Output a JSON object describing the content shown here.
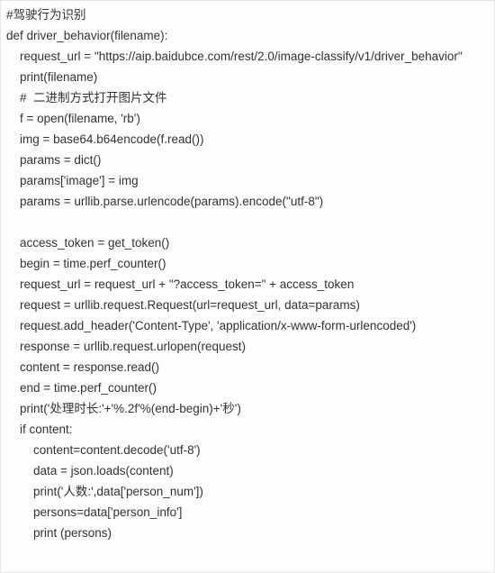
{
  "code": {
    "lines": [
      "#驾驶行为识别",
      "def driver_behavior(filename):",
      "    request_url = \"https://aip.baidubce.com/rest/2.0/image-classify/v1/driver_behavior\"",
      "    print(filename)",
      "    #  二进制方式打开图片文件",
      "    f = open(filename, 'rb')",
      "    img = base64.b64encode(f.read())",
      "    params = dict()",
      "    params['image'] = img",
      "    params = urllib.parse.urlencode(params).encode(\"utf-8\")",
      "",
      "    access_token = get_token()",
      "    begin = time.perf_counter()",
      "    request_url = request_url + \"?access_token=\" + access_token",
      "    request = urllib.request.Request(url=request_url, data=params)",
      "    request.add_header('Content-Type', 'application/x-www-form-urlencoded')",
      "    response = urllib.request.urlopen(request)",
      "    content = response.read()",
      "    end = time.perf_counter()",
      "    print('处理时长:'+'%.2f'%(end-begin)+'秒')",
      "    if content:",
      "        content=content.decode('utf-8')",
      "        data = json.loads(content)",
      "        print('人数:',data['person_num'])",
      "        persons=data['person_info']",
      "        print (persons)"
    ]
  }
}
